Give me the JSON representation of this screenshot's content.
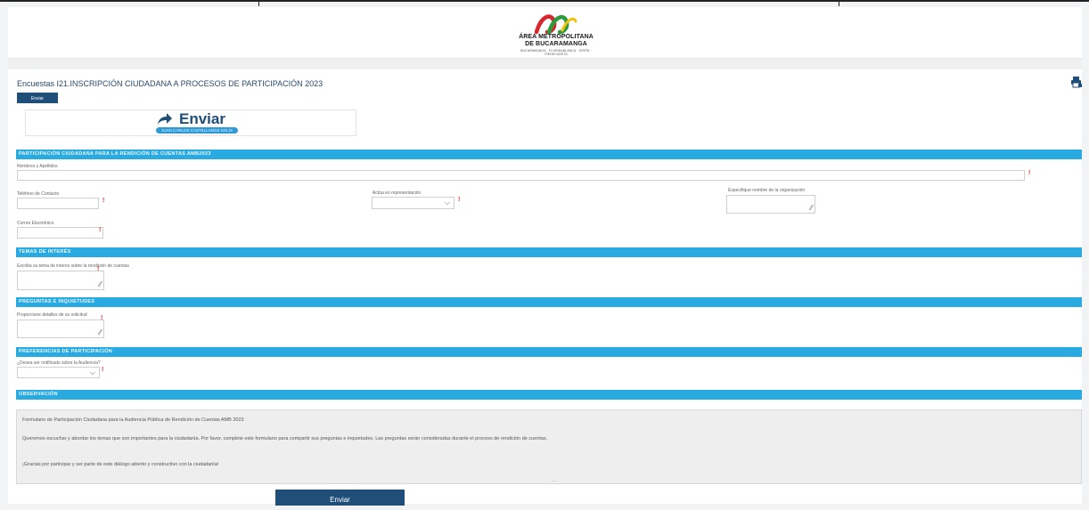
{
  "header": {
    "logo_line1": "ÁREA METROPOLITANA",
    "logo_line2": "DE BUCARAMANGA",
    "logo_tagline": "BUCARAMANGA · FLORIDABLANCA · GIRÓN · PIEDECUESTA"
  },
  "survey": {
    "title": "Encuestas I21.INSCRIPCIÓN CIUDADANA A PROCESOS DE PARTICIPACIÓN 2023",
    "small_button_label": "Enviar",
    "send_label": "Enviar",
    "send_user": "JUAN CARLOS CASTELLANOS SOLÍS"
  },
  "sections": {
    "s1": "PARTICIPACIÓN CIUDADANA PARA LA RENDICIÓN DE CUENTAS AMB2023",
    "s2": "TEMAS DE INTERÉS",
    "s3": "PREGUNTAS E INQUIETUDES",
    "s4": "PREFERENCIAS DE PARTICIPACIÓN",
    "s5": "OBSERVACIÓN"
  },
  "fields": {
    "nombres_label": "Nombres y Apellidos",
    "telefono_label": "Teléfono de Contacto",
    "actua_label": "Actúa en representación",
    "especifique_label": "Especifique nombre de la organización",
    "correo_label": "Correo Electrónico",
    "tema_label": "Escriba su tema de interés sobre la rendición de cuentas",
    "detalles_label": "Proporcione detalles de su solicitud",
    "notificado_label": "¿Desea ser notificado sobre la Audiencia?",
    "required_mark": "!"
  },
  "observacion": {
    "line1": "Formulario de Participación Ciudadana para la Audiencia Pública de Rendición de Cuentas AMB 2023",
    "line2": "Queremos escuchar y abordar los temas que son importantes para la ciudadanía. Por favor, complete este formulario para compartir sus preguntas e inquietudes. Las preguntas serán consideradas durante el proceso de rendición de cuentas.",
    "line3": "¡Gracias por participar y ser parte de este diálogo abierto y constructivo con la ciudadanía!"
  },
  "footer": {
    "submit_label": "Enviar"
  },
  "icons": {
    "print": "print-icon",
    "send_arrow": "share-arrow-icon",
    "chevron": "chevron-down-icon",
    "resize": "resize-grip-icon"
  },
  "colors": {
    "section_bar": "#29abe2",
    "primary_button": "#1f4e79",
    "required": "#e0312c",
    "logo_red": "#d8262e",
    "logo_green": "#2e9a3e",
    "logo_yellow": "#f4c20d"
  }
}
